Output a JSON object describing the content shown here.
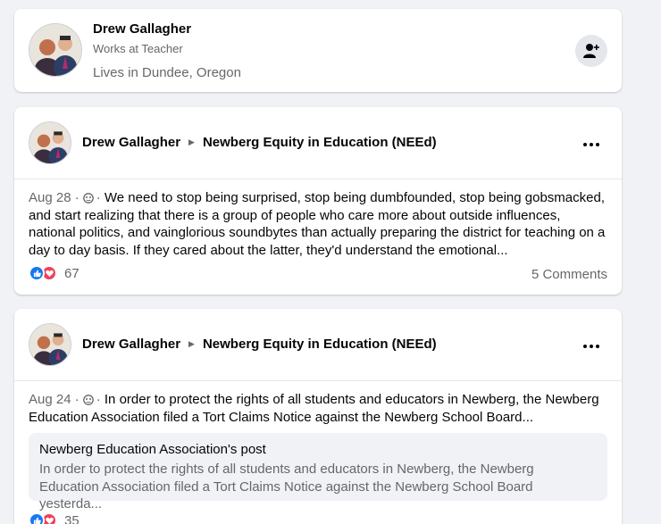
{
  "profile": {
    "name": "Drew Gallagher",
    "work": "Works at Teacher",
    "lives": "Lives in Dundee, Oregon"
  },
  "posts": [
    {
      "author": "Drew Gallagher",
      "group": "Newberg Equity in Education (NEEd)",
      "date": "Aug 28",
      "separator": "·",
      "text": "We need to stop being surprised, stop being dumbfounded, stop being gobsmacked, and start realizing that there is a group of people who care more about outside influences, national politics, and vainglorious soundbytes than actually preparing the district for teaching on a day to day basis. If they cared about the latter, they'd understand the emotional...",
      "reaction_count": "67",
      "comments": "5 Comments"
    },
    {
      "author": "Drew Gallagher",
      "group": "Newberg Equity in Education (NEEd)",
      "date": "Aug 24",
      "separator": "·",
      "text": "In order to protect the rights of all students and educators in Newberg, the Newberg Education Association filed a Tort Claims Notice against the Newberg School Board...",
      "shared_title": "Newberg Education Association's post",
      "shared_text": "In order to protect the rights of all students and educators in Newberg, the Newberg Education Association filed a Tort Claims Notice against the Newberg School Board yesterda...",
      "reaction_count": "35"
    }
  ],
  "icons": {
    "add_friend": "add-friend-icon",
    "more": "more-options-icon",
    "audience": "globe-icon",
    "like": "like-reaction-icon",
    "love": "love-reaction-icon"
  },
  "colors": {
    "like": "#1877f2",
    "love": "#f33e58",
    "secondary_text": "#65676b",
    "background": "#f0f2f5"
  }
}
